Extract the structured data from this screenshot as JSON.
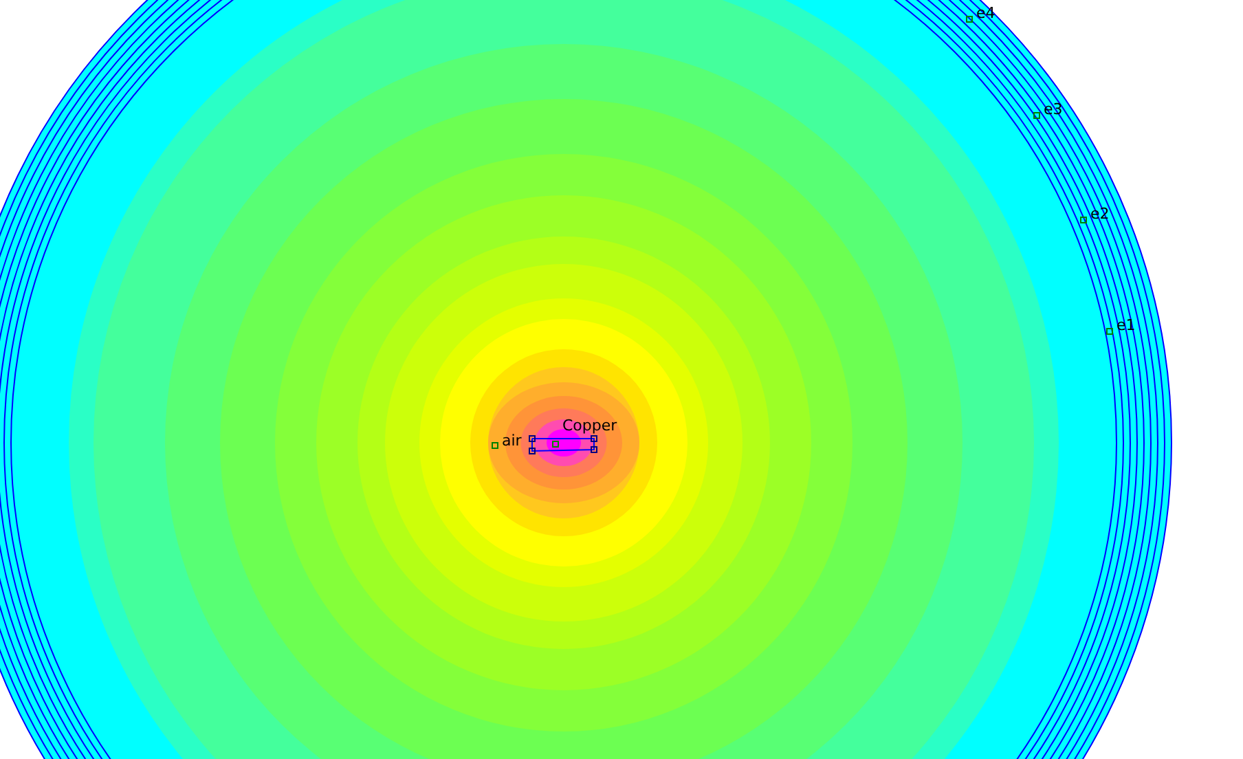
{
  "block_labels": [
    {
      "text": "air"
    },
    {
      "text": "Copper"
    }
  ],
  "boundary_labels": [
    {
      "text": "e4"
    },
    {
      "text": "e3"
    },
    {
      "text": "e2"
    },
    {
      "text": "e1"
    }
  ]
}
